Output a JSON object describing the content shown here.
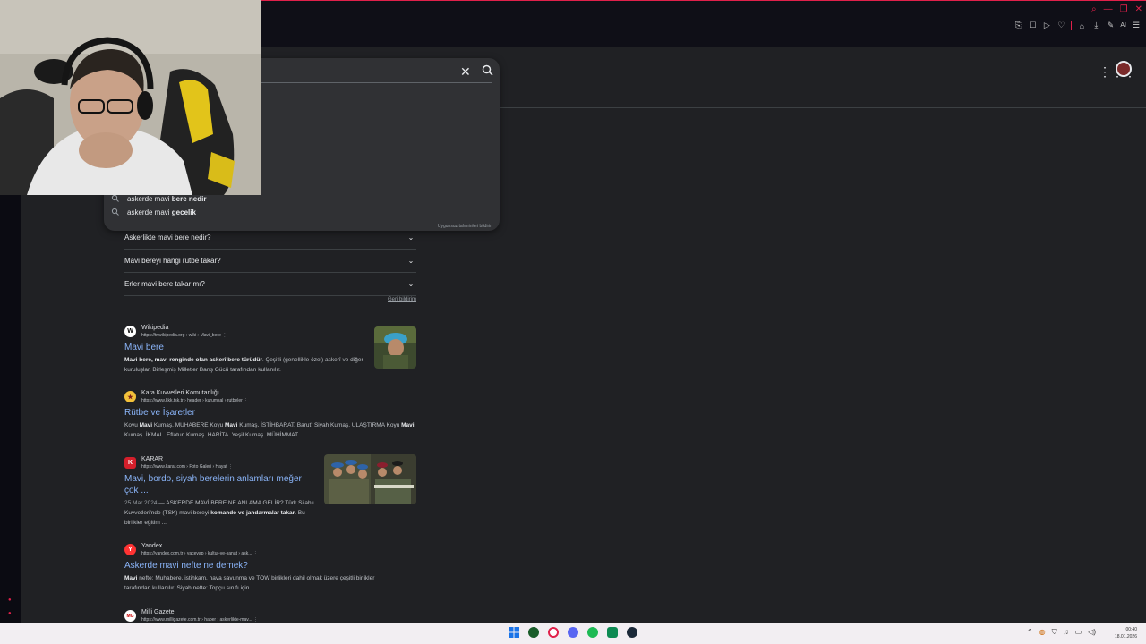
{
  "browser": {
    "window_controls": [
      "⌕",
      "—",
      "❐",
      "✕"
    ],
    "toolbar_icons": [
      "⎘",
      "☐",
      "▷",
      "♡",
      "⌂",
      "⤓",
      "✎",
      "☰"
    ],
    "ai_label": "AI"
  },
  "search": {
    "suggestions": [
      {
        "prefix": "askerde mavi ",
        "bold": "bere nedir"
      },
      {
        "prefix": "askerde mavi ",
        "bold": "gecelik"
      }
    ],
    "report_label": "Uygunsuz tahminleri bildirin"
  },
  "related_questions": [
    "Askerlikte mavi bere nedir?",
    "Mavi bereyi hangi rütbe takar?",
    "Erler mavi bere takar mı?"
  ],
  "feedback_label": "Geri bildirim",
  "results": [
    {
      "site": "Wikipedia",
      "url": "https://tr.wikipedia.org › wiki › Mavi_bere",
      "title": "Mavi bere",
      "snippet_html_parts": [
        {
          "b": true,
          "t": "Mavi bere, mavi renginde olan askerî bere türüdür"
        },
        {
          "b": false,
          "t": ". Çeşitli (genellikle özel) askerî ve diğer kuruluşlar, Birleşmiş Milletler Barış Gücü tarafından kullanılır."
        }
      ],
      "favicon": "W"
    },
    {
      "site": "Kara Kuvvetleri Komutanlığı",
      "url": "https://www.kkk.tsk.tr › header › kurumsal › rutbeler",
      "title": "Rütbe ve İşaretler",
      "snippet_html_parts": [
        {
          "b": false,
          "t": "Koyu "
        },
        {
          "b": true,
          "t": "Mavi"
        },
        {
          "b": false,
          "t": " Kumaş. MUHABERE Koyu "
        },
        {
          "b": true,
          "t": "Mavi"
        },
        {
          "b": false,
          "t": " Kumaş. İSTİHBARAT. Barutî Siyah Kumaş. ULAŞTIRMA Koyu "
        },
        {
          "b": true,
          "t": "Mavi"
        },
        {
          "b": false,
          "t": " Kumaş. İKMAL. Eflatun Kumaş. HARİTA. Yeşil Kumaş. MÜHİMMAT"
        }
      ],
      "favicon": "★"
    },
    {
      "site": "KARAR",
      "url": "https://www.karar.com › Foto Galeri › Hayat",
      "title": "Mavi, bordo, siyah berelerin anlamları meğer çok ...",
      "date": "25 Mar 2024",
      "snippet_html_parts": [
        {
          "b": false,
          "t": " — ASKERDE MAVİ BERE NE ANLAMA GELİR? Türk Silahlı Kuvvetleri'nde (TSK) mavi bereyi "
        },
        {
          "b": true,
          "t": "komando ve jandarmalar takar"
        },
        {
          "b": false,
          "t": ". Bu birlikler eğitim ..."
        }
      ],
      "favicon": "K"
    },
    {
      "site": "Yandex",
      "url": "https://yandex.com.tr › yacevap › kultur-ve-sanat › ask...",
      "title": "Askerde mavi nefte ne demek?",
      "snippet_html_parts": [
        {
          "b": true,
          "t": "Mavi"
        },
        {
          "b": false,
          "t": " nefte: Muhabere, istihkam, hava savunma ve TOW birlikleri dahil olmak üzere çeşitli birlikler tarafından kullanılır. Siyah nefte: Topçu sınıfı için ..."
        }
      ],
      "favicon": "Y"
    },
    {
      "site": "Milli Gazete",
      "url": "https://www.milligazete.com.tr › haber › askerlikte-mav...",
      "favicon": "MG"
    }
  ],
  "taskbar": {
    "clock_time": "00:40",
    "clock_date": "18.01.2026"
  },
  "colors": {
    "accent_red": "#e0204a",
    "link_blue": "#8ab4f8",
    "bg": "#202124"
  }
}
